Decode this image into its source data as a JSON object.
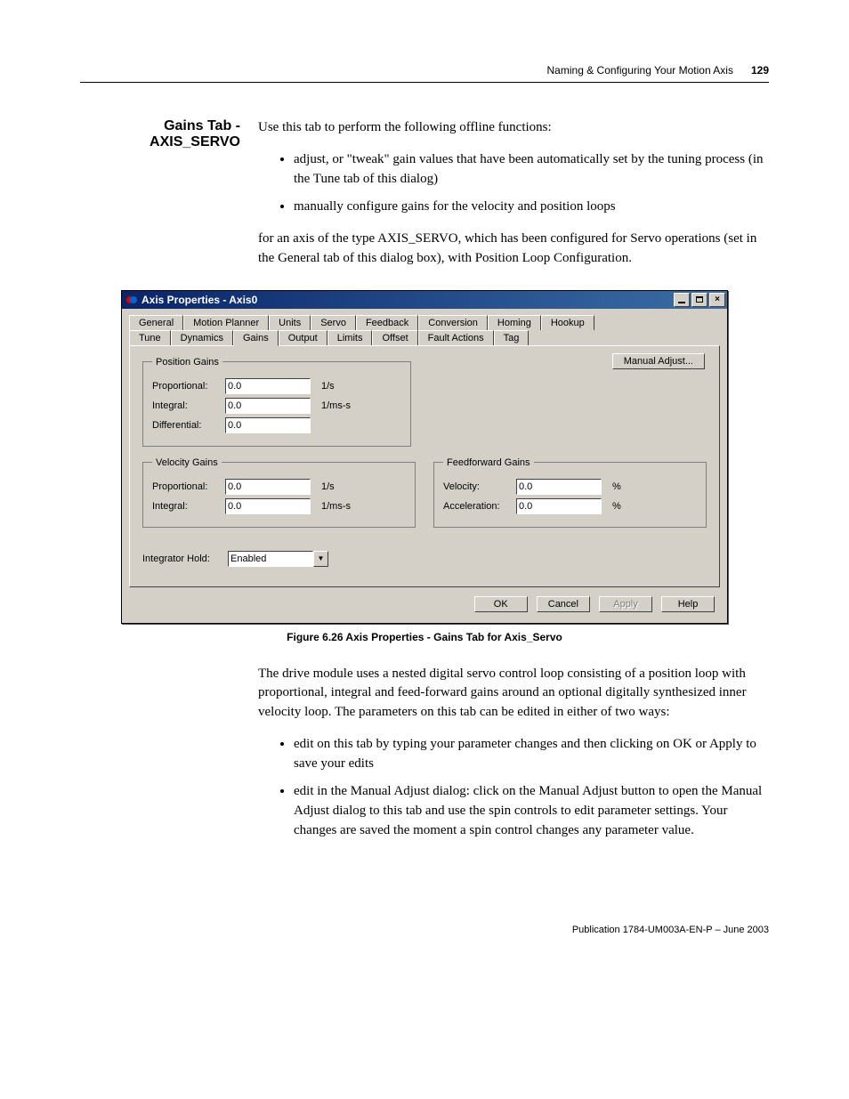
{
  "header": {
    "chapter": "Naming & Configuring Your Motion Axis",
    "pagenum": "129"
  },
  "section": {
    "heading": "Gains Tab - AXIS_SERVO",
    "intro": "Use this tab to perform the following offline functions:",
    "bullets_top": [
      "adjust, or \"tweak\" gain values that have been automatically set by the tuning process (in the Tune tab of this dialog)",
      "manually configure gains for the velocity and position loops"
    ],
    "para_after_bullets": "for an axis of the type AXIS_SERVO, which has been configured for Servo operations (set in the General tab of this dialog box), with Position Loop Configuration."
  },
  "dialog": {
    "title": "Axis Properties - Axis0",
    "tabs_row1": [
      "General",
      "Motion Planner",
      "Units",
      "Servo",
      "Feedback",
      "Conversion",
      "Homing",
      "Hookup"
    ],
    "tabs_row2": [
      "Tune",
      "Dynamics",
      "Gains",
      "Output",
      "Limits",
      "Offset",
      "Fault Actions",
      "Tag"
    ],
    "active_tab": "Gains",
    "manual_adjust": "Manual Adjust...",
    "groups": {
      "position": {
        "legend": "Position Gains",
        "proportional": {
          "label": "Proportional:",
          "value": "0.0",
          "unit": "1/s"
        },
        "integral": {
          "label": "Integral:",
          "value": "0.0",
          "unit": "1/ms-s"
        },
        "differential": {
          "label": "Differential:",
          "value": "0.0",
          "unit": ""
        }
      },
      "velocity": {
        "legend": "Velocity Gains",
        "proportional": {
          "label": "Proportional:",
          "value": "0.0",
          "unit": "1/s"
        },
        "integral": {
          "label": "Integral:",
          "value": "0.0",
          "unit": "1/ms-s"
        }
      },
      "feedforward": {
        "legend": "Feedforward Gains",
        "velocity": {
          "label": "Velocity:",
          "value": "0.0",
          "unit": "%"
        },
        "acceleration": {
          "label": "Acceleration:",
          "value": "0.0",
          "unit": "%"
        }
      }
    },
    "integrator_hold": {
      "label": "Integrator Hold:",
      "value": "Enabled"
    },
    "buttons": {
      "ok": "OK",
      "cancel": "Cancel",
      "apply": "Apply",
      "help": "Help"
    }
  },
  "figure_caption": "Figure 6.26 Axis Properties - Gains Tab for Axis_Servo",
  "body_lower": {
    "para": "The drive module uses a nested digital servo control loop consisting of a position loop with proportional, integral and feed-forward gains around an optional digitally synthesized inner velocity loop. The parameters on this tab can be edited in either of two ways:",
    "bullets": [
      "edit on this tab by typing your parameter changes and then clicking on OK or Apply to save your edits",
      "edit in the Manual Adjust dialog: click on the Manual Adjust button to open the Manual Adjust dialog to this tab and use the spin controls to edit parameter settings. Your changes are saved the moment a spin control changes any parameter value."
    ]
  },
  "footer": "Publication 1784-UM003A-EN-P – June 2003"
}
